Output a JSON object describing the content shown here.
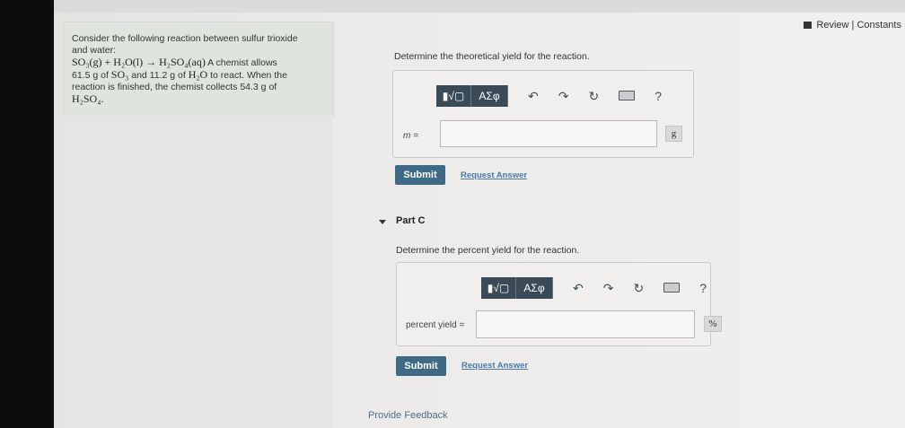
{
  "header": {
    "review_constants": "Review | Constants"
  },
  "problem": {
    "line1": "Consider the following reaction between sulfur trioxide",
    "line2": "and water:",
    "equation": "SO₃(g) + H₂O(l) → H₂SO₄(aq)",
    "line3": " A chemist allows",
    "line4a": "61.5 g of ",
    "so3": "SO₃",
    "line4b": " and 11.2 g of ",
    "h2o": "H₂O",
    "line4c": " to react. When the",
    "line5": "reaction is finished, the chemist collects 54.3 g of",
    "product": "H₂SO₄."
  },
  "part_b": {
    "prompt": "Determine the theoretical yield for the reaction.",
    "field_label": "m =",
    "input_value": "",
    "unit": "g",
    "submit": "Submit",
    "request": "Request Answer"
  },
  "part_c": {
    "title": "Part C",
    "prompt": "Determine the percent yield for the reaction.",
    "field_label": "percent yield =",
    "input_value": "",
    "unit": "%",
    "submit": "Submit",
    "request": "Request Answer"
  },
  "toolbar": {
    "templates": "▮√▢",
    "greek": "ΑΣφ",
    "undo": "↶",
    "redo": "↷",
    "reset": "↻",
    "help": "?"
  },
  "footer": {
    "feedback": "Provide Feedback"
  }
}
